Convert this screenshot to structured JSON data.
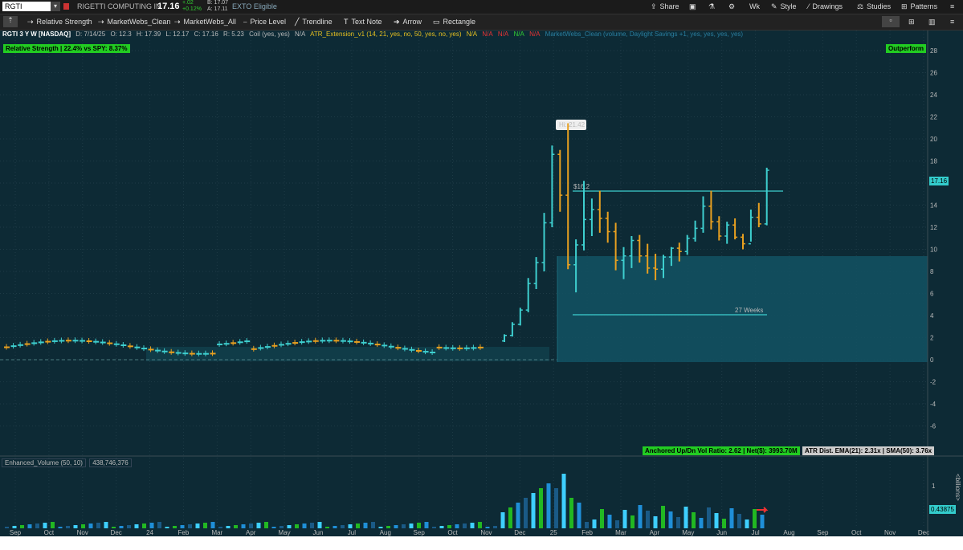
{
  "header": {
    "symbol": "RGTI",
    "company": "RIGETTI COMPUTING IN",
    "last": "17.16",
    "change": "+.02",
    "change_pct": "+0.12%",
    "bid": "B: 17.07",
    "ask": "A: 17.11",
    "eligibility": "EXTO Eligible",
    "buttons": [
      "Share",
      "Wk",
      "Style",
      "Drawings",
      "Studies",
      "Patterns"
    ]
  },
  "toolbar": {
    "items": [
      "Relative Strength",
      "MarketWebs_Clean",
      "MarketWebs_All",
      "Price Level",
      "Trendline",
      "Text Note",
      "Arrow",
      "Rectangle"
    ]
  },
  "info": {
    "title": "RGTI 3 Y W [NASDAQ]",
    "date": "D: 7/14/25",
    "open": "O: 12.3",
    "high": "H: 17.39",
    "low": "L: 12.17",
    "close": "C: 17.16",
    "range": "R: 5.23",
    "coil": "Coil (yes, yes)",
    "na1": "N/A",
    "atr_study": "ATR_Extension_v1 (14, 21, yes, no, 50, yes, no, yes)",
    "na2": "N/A",
    "na3": "N/A",
    "na4": "N/A",
    "na5": "N/A",
    "na6": "N/A",
    "mw_study": "MarketWebs_Clean (volume, Daylight Savings +1, yes, yes, yes, yes)"
  },
  "labels": {
    "relative_strength": "Relative Strength | 22.4% vs SPY: 8.37%",
    "outperform": "Outperform",
    "anchored": "Anchored Up/Dn Vol Ratio: 2.62 | Net($): 3993.70M",
    "atr_dist": "ATR Dist. EMA(21): 2.31x | SMA(50): 3.76x",
    "hi": "Hi: 21.42",
    "level": "$16.2",
    "base_length": "27 Weeks",
    "price_tag": "17.16",
    "volume_study": "Enhanced_Volume (50, 10)",
    "volume_value": "438,746,376",
    "volume_tag": "0.43875",
    "volume_unit": "<billions>"
  },
  "colors": {
    "up": "#3ecfcf",
    "down": "#e8a020",
    "vol_green": "#22b822",
    "vol_cyan": "#3ecfff",
    "vol_blue": "#1f8fd8",
    "vol_dark": "#1a5a86",
    "tag_green": "#22cc22"
  },
  "chart_data": {
    "type": "candlestick",
    "interval": "weekly",
    "y_ticks": [
      28,
      26,
      24,
      22,
      20,
      18,
      16,
      14,
      12,
      10,
      8,
      6,
      4,
      2,
      0,
      -2,
      -4,
      -6
    ],
    "ylim": [
      -7,
      29
    ],
    "x_ticks": [
      "Sep",
      "Oct",
      "Nov",
      "Dec",
      "24",
      "Feb",
      "Mar",
      "Apr",
      "May",
      "Jun",
      "Jul",
      "Aug",
      "Sep",
      "Oct",
      "Nov",
      "Dec",
      "25",
      "Feb",
      "Mar",
      "Apr",
      "May",
      "Jun",
      "Jul",
      "Aug",
      "Sep",
      "Oct",
      "Nov",
      "Dec"
    ],
    "volume_ticks": [
      1
    ],
    "weekly_bars": [
      {
        "w": "2024-11-25",
        "o": 1.7,
        "h": 2.3,
        "l": 1.6,
        "c": 2.2
      },
      {
        "w": "2024-12-02",
        "o": 2.2,
        "h": 3.4,
        "l": 2.1,
        "c": 3.2
      },
      {
        "w": "2024-12-09",
        "o": 3.2,
        "h": 4.7,
        "l": 3.1,
        "c": 4.5
      },
      {
        "w": "2024-12-16",
        "o": 4.5,
        "h": 7.4,
        "l": 4.3,
        "c": 6.9
      },
      {
        "w": "2024-12-23",
        "o": 6.9,
        "h": 9.3,
        "l": 6.4,
        "c": 8.8
      },
      {
        "w": "2024-12-30",
        "o": 8.8,
        "h": 13.3,
        "l": 8.0,
        "c": 12.4
      },
      {
        "w": "2025-01-06",
        "o": 12.4,
        "h": 19.4,
        "l": 12.0,
        "c": 18.6
      },
      {
        "w": "2025-01-13",
        "o": 18.6,
        "h": 19.0,
        "l": 13.4,
        "c": 14.9
      },
      {
        "w": "2025-01-20",
        "o": 14.9,
        "h": 21.42,
        "l": 8.2,
        "c": 8.6
      },
      {
        "w": "2025-01-27",
        "o": 8.6,
        "h": 10.9,
        "l": 6.1,
        "c": 10.4
      },
      {
        "w": "2025-02-03",
        "o": 10.4,
        "h": 16.2,
        "l": 9.9,
        "c": 12.7
      },
      {
        "w": "2025-02-10",
        "o": 12.7,
        "h": 14.6,
        "l": 11.2,
        "c": 13.6
      },
      {
        "w": "2025-02-17",
        "o": 13.6,
        "h": 15.3,
        "l": 11.5,
        "c": 12.8
      },
      {
        "w": "2025-02-24",
        "o": 12.8,
        "h": 13.4,
        "l": 10.6,
        "c": 11.6
      },
      {
        "w": "2025-03-03",
        "o": 11.6,
        "h": 12.4,
        "l": 8.1,
        "c": 9.0
      },
      {
        "w": "2025-03-10",
        "o": 9.0,
        "h": 10.2,
        "l": 7.3,
        "c": 9.4
      },
      {
        "w": "2025-03-17",
        "o": 9.4,
        "h": 11.2,
        "l": 8.3,
        "c": 10.8
      },
      {
        "w": "2025-03-24",
        "o": 10.8,
        "h": 11.3,
        "l": 8.8,
        "c": 9.4
      },
      {
        "w": "2025-03-31",
        "o": 9.4,
        "h": 10.5,
        "l": 7.8,
        "c": 8.3
      },
      {
        "w": "2025-04-07",
        "o": 8.3,
        "h": 9.6,
        "l": 7.2,
        "c": 8.2
      },
      {
        "w": "2025-04-14",
        "o": 8.2,
        "h": 9.5,
        "l": 7.4,
        "c": 9.3
      },
      {
        "w": "2025-04-21",
        "o": 9.3,
        "h": 10.2,
        "l": 8.5,
        "c": 10.1
      },
      {
        "w": "2025-04-28",
        "o": 10.1,
        "h": 10.6,
        "l": 8.9,
        "c": 9.8
      },
      {
        "w": "2025-05-05",
        "o": 9.8,
        "h": 11.3,
        "l": 9.5,
        "c": 11.0
      },
      {
        "w": "2025-05-12",
        "o": 11.0,
        "h": 12.6,
        "l": 10.7,
        "c": 11.9
      },
      {
        "w": "2025-05-19",
        "o": 11.9,
        "h": 14.8,
        "l": 11.5,
        "c": 13.9
      },
      {
        "w": "2025-05-26",
        "o": 13.9,
        "h": 15.3,
        "l": 11.8,
        "c": 12.5
      },
      {
        "w": "2025-06-02",
        "o": 12.5,
        "h": 13.0,
        "l": 10.8,
        "c": 11.2
      },
      {
        "w": "2025-06-09",
        "o": 11.2,
        "h": 12.5,
        "l": 10.5,
        "c": 12.2
      },
      {
        "w": "2025-06-16",
        "o": 12.2,
        "h": 12.8,
        "l": 10.9,
        "c": 11.1
      },
      {
        "w": "2025-06-23",
        "o": 11.1,
        "h": 11.4,
        "l": 10.0,
        "c": 10.5
      },
      {
        "w": "2025-06-30",
        "o": 10.5,
        "h": 13.6,
        "l": 10.7,
        "c": 12.9
      },
      {
        "w": "2025-07-07",
        "o": 12.9,
        "h": 14.2,
        "l": 12.0,
        "c": 12.3
      },
      {
        "w": "2025-07-14",
        "o": 12.3,
        "h": 17.39,
        "l": 12.17,
        "c": 17.16
      }
    ]
  }
}
